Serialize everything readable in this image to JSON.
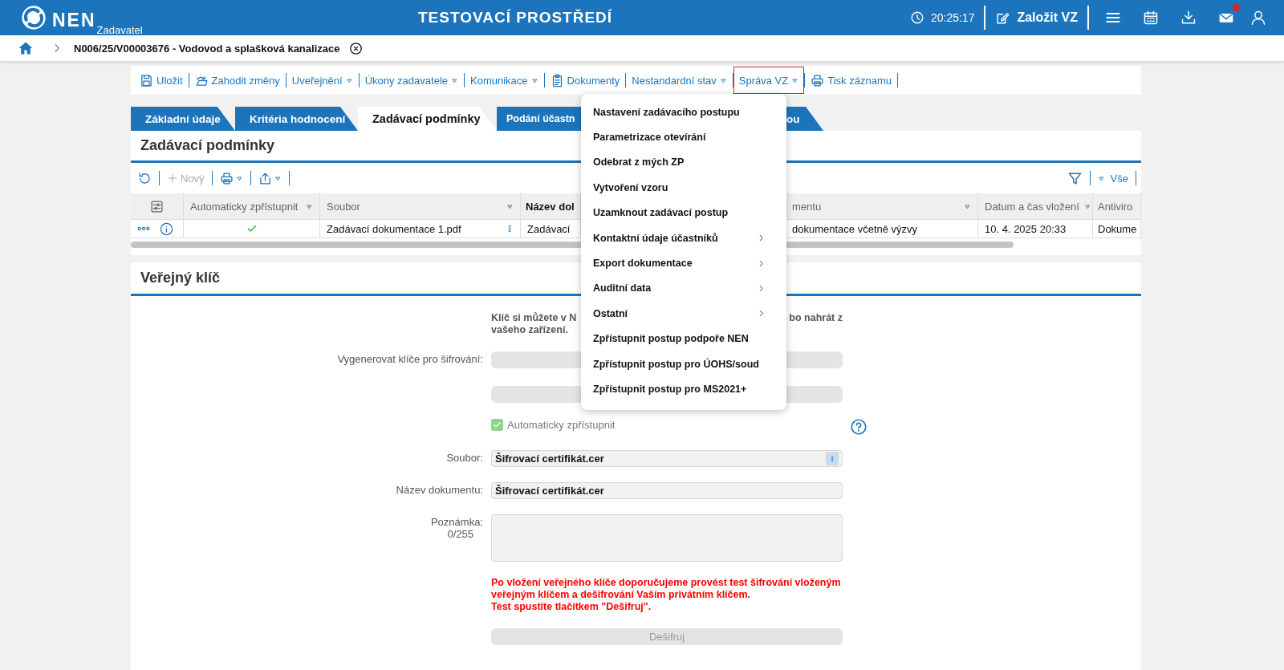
{
  "header": {
    "logo_text": "NEN",
    "logo_subtitle": "Zadavatel",
    "environment": "TESTOVACÍ PROSTŘEDÍ",
    "time": "20:25:17",
    "create_button": "Založit VZ",
    "mail_unread": true
  },
  "breadcrumb": {
    "title": "N006/25/V00003676 - Vodovod a splašková kanalizace"
  },
  "toolbar": [
    {
      "label": "Uložit",
      "kind": "save",
      "open": false
    },
    {
      "label": "Zahodit změny",
      "kind": "discard",
      "open": false
    },
    {
      "label": "Uveřejnění",
      "kind": "dropdown",
      "open": false
    },
    {
      "label": "Úkony zadavatele",
      "kind": "dropdown",
      "open": false
    },
    {
      "label": "Komunikace",
      "kind": "dropdown",
      "open": false
    },
    {
      "label": "Dokumenty",
      "kind": "document",
      "open": false
    },
    {
      "label": "Nestandardní stav",
      "kind": "dropdown",
      "open": false
    },
    {
      "label": "Správa VZ",
      "kind": "dropdown",
      "open": true
    },
    {
      "label": "Tisk záznamu",
      "kind": "print",
      "open": false
    }
  ],
  "tabs": [
    {
      "label": "Základní údaje",
      "selected": false
    },
    {
      "label": "Kritéria hodnocení",
      "selected": false
    },
    {
      "label": "Zadávací podmínky",
      "selected": true
    },
    {
      "label": "Podání účastn",
      "selected": false
    },
    {
      "label": "ou",
      "selected": false
    }
  ],
  "conditions_section": {
    "title": "Zadávací podmínky",
    "new_button": "Nový",
    "view_filter": "Vše",
    "table": {
      "columns": [
        {
          "label": "Automaticky zpřístupnit",
          "filterable": true
        },
        {
          "label": "Soubor",
          "filterable": true
        },
        {
          "label": "Název dol",
          "filterable": false
        },
        {
          "label": "mentu",
          "filterable": true
        },
        {
          "label": "Datum a čas vložení",
          "filterable": true
        },
        {
          "label": "Antiviro",
          "filterable": false
        }
      ],
      "rows": [
        {
          "auto_access": true,
          "cells": [
            "",
            "Zadávací dokumentace 1.pdf",
            "Zadávací",
            "dokumentace včetně výzvy",
            "10. 4. 2025 20:33",
            "Dokume"
          ]
        }
      ]
    }
  },
  "public_key_section": {
    "title": "Veřejný klíč",
    "intro_parts": [
      "Klíč si můžete v N",
      "bo nahrát z",
      "vašeho zařízení."
    ],
    "generate_label": "Vygenerovat klíče pro šifrování:",
    "auto_access": {
      "label": "Automaticky zpřístupnit",
      "checked": true,
      "disabled": true
    },
    "file": {
      "label": "Soubor:",
      "value": "Šifrovací certifikát.cer"
    },
    "document_name": {
      "label": "Název dokumentu:",
      "value": "Šifrovací certifikát.cer"
    },
    "note": {
      "label": "Poznámka:",
      "counter": "0/255"
    },
    "warning": "Po vložení veřejného klíče doporučujeme provést test šifrování vloženým\nveřejným klíčem a dešifrování Vaším privátním klíčem.\nTest spustíte tlačítkem \"Dešifruj\".",
    "decrypt_button": {
      "label": "Dešifruj",
      "disabled": true
    }
  },
  "menu": {
    "items": [
      {
        "label": "Nastavení zadávacího postupu",
        "has_submenu": false
      },
      {
        "label": "Parametrizace otevírání",
        "has_submenu": false
      },
      {
        "label": "Odebrat z mých ZP",
        "has_submenu": false
      },
      {
        "label": "Vytvoření vzoru",
        "has_submenu": false
      },
      {
        "label": "Uzamknout zadávací postup",
        "has_submenu": false
      },
      {
        "label": "Kontaktní údaje účastníků",
        "has_submenu": true
      },
      {
        "label": "Export dokumentace",
        "has_submenu": true
      },
      {
        "label": "Auditní data",
        "has_submenu": true
      },
      {
        "label": "Ostatní",
        "has_submenu": true
      },
      {
        "label": "Zpřístupnit postup podpoře NEN",
        "has_submenu": false
      },
      {
        "label": "Zpřístupnit postup pro ÚOHS/soud",
        "has_submenu": false
      },
      {
        "label": "Zpřístupnit postup pro MS2021+",
        "has_submenu": false
      }
    ]
  }
}
